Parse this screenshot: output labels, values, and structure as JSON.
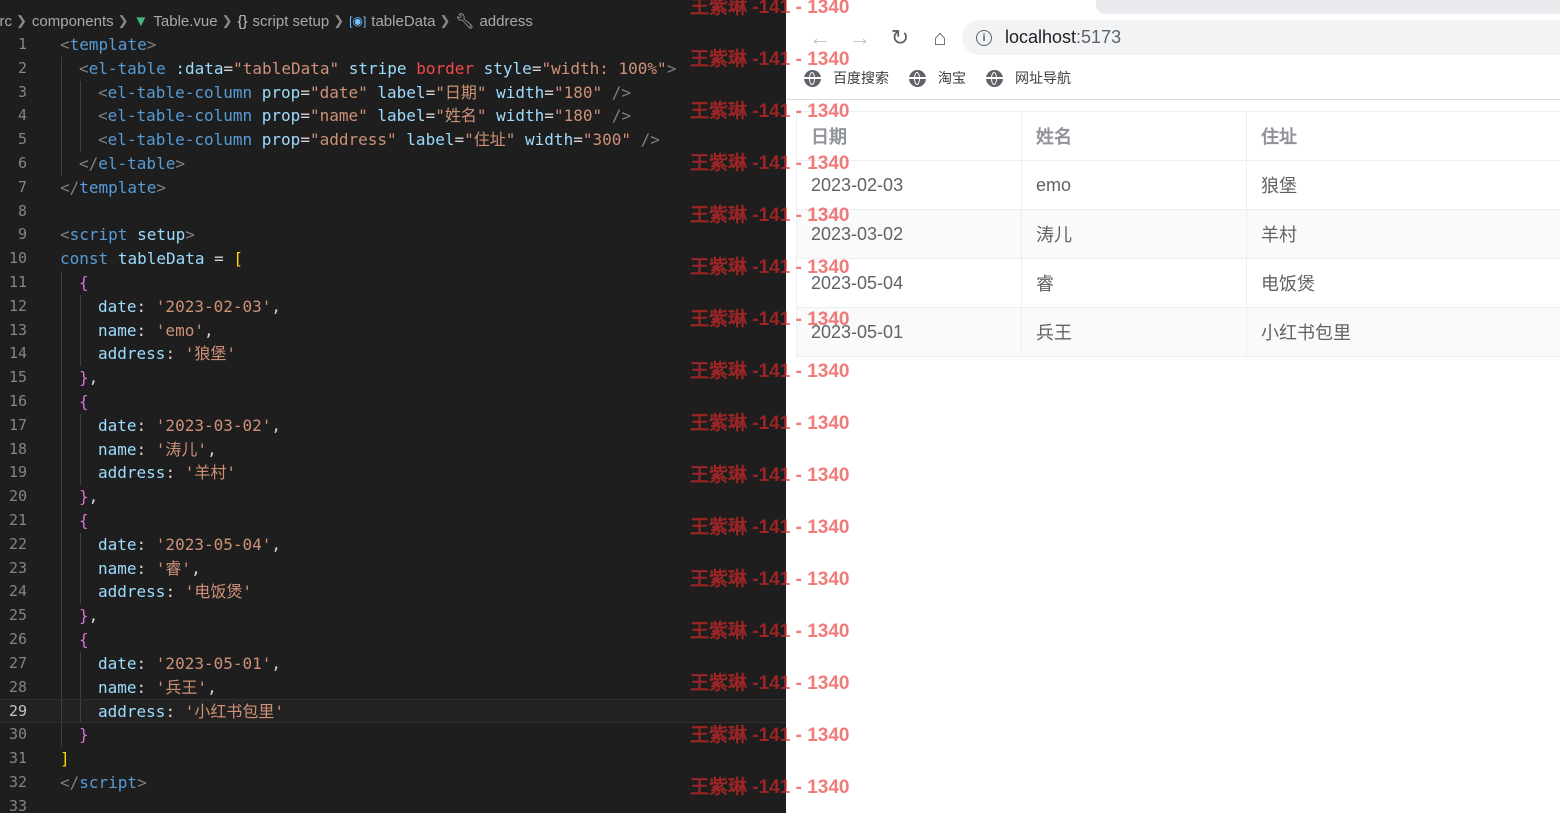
{
  "editor": {
    "breadcrumb": [
      "src",
      "components",
      "Table.vue",
      "script setup",
      "tableData",
      "address"
    ],
    "current_line": 29,
    "lines": [
      {
        "n": "1",
        "indent": 0,
        "tokens": [
          [
            "t-punct",
            "<"
          ],
          [
            "t-tag",
            "template"
          ],
          [
            "t-punct",
            ">"
          ]
        ]
      },
      {
        "n": "2",
        "indent": 1,
        "tokens": [
          [
            "t-punct",
            "<"
          ],
          [
            "t-tag",
            "el-table"
          ],
          [
            "t-eq",
            " "
          ],
          [
            "t-attr",
            ":data"
          ],
          [
            "t-eq",
            "="
          ],
          [
            "t-str",
            "\"tableData\""
          ],
          [
            "t-eq",
            " "
          ],
          [
            "t-attr",
            "stripe"
          ],
          [
            "t-eq",
            " "
          ],
          [
            "t-red",
            "border"
          ],
          [
            "t-eq",
            " "
          ],
          [
            "t-attr",
            "style"
          ],
          [
            "t-eq",
            "="
          ],
          [
            "t-str",
            "\"width: 100%\""
          ],
          [
            "t-punct",
            ">"
          ]
        ]
      },
      {
        "n": "3",
        "indent": 2,
        "tokens": [
          [
            "t-punct",
            "<"
          ],
          [
            "t-tag",
            "el-table-column"
          ],
          [
            "t-eq",
            " "
          ],
          [
            "t-attr",
            "prop"
          ],
          [
            "t-eq",
            "="
          ],
          [
            "t-str",
            "\"date\""
          ],
          [
            "t-eq",
            " "
          ],
          [
            "t-attr",
            "label"
          ],
          [
            "t-eq",
            "="
          ],
          [
            "t-str",
            "\"日期\""
          ],
          [
            "t-eq",
            " "
          ],
          [
            "t-attr",
            "width"
          ],
          [
            "t-eq",
            "="
          ],
          [
            "t-str",
            "\"180\""
          ],
          [
            "t-eq",
            " "
          ],
          [
            "t-punct",
            "/>"
          ]
        ]
      },
      {
        "n": "4",
        "indent": 2,
        "tokens": [
          [
            "t-punct",
            "<"
          ],
          [
            "t-tag",
            "el-table-column"
          ],
          [
            "t-eq",
            " "
          ],
          [
            "t-attr",
            "prop"
          ],
          [
            "t-eq",
            "="
          ],
          [
            "t-str",
            "\"name\""
          ],
          [
            "t-eq",
            " "
          ],
          [
            "t-attr",
            "label"
          ],
          [
            "t-eq",
            "="
          ],
          [
            "t-str",
            "\"姓名\""
          ],
          [
            "t-eq",
            " "
          ],
          [
            "t-attr",
            "width"
          ],
          [
            "t-eq",
            "="
          ],
          [
            "t-str",
            "\"180\""
          ],
          [
            "t-eq",
            " "
          ],
          [
            "t-punct",
            "/>"
          ]
        ]
      },
      {
        "n": "5",
        "indent": 2,
        "tokens": [
          [
            "t-punct",
            "<"
          ],
          [
            "t-tag",
            "el-table-column"
          ],
          [
            "t-eq",
            " "
          ],
          [
            "t-attr",
            "prop"
          ],
          [
            "t-eq",
            "="
          ],
          [
            "t-str",
            "\"address\""
          ],
          [
            "t-eq",
            " "
          ],
          [
            "t-attr",
            "label"
          ],
          [
            "t-eq",
            "="
          ],
          [
            "t-str",
            "\"住址\""
          ],
          [
            "t-eq",
            " "
          ],
          [
            "t-attr",
            "width"
          ],
          [
            "t-eq",
            "="
          ],
          [
            "t-str",
            "\"300\""
          ],
          [
            "t-eq",
            " "
          ],
          [
            "t-punct",
            "/>"
          ]
        ]
      },
      {
        "n": "6",
        "indent": 1,
        "tokens": [
          [
            "t-punct",
            "</"
          ],
          [
            "t-tag",
            "el-table"
          ],
          [
            "t-punct",
            ">"
          ]
        ]
      },
      {
        "n": "7",
        "indent": 0,
        "tokens": [
          [
            "t-punct",
            "</"
          ],
          [
            "t-tag",
            "template"
          ],
          [
            "t-punct",
            ">"
          ]
        ]
      },
      {
        "n": "8",
        "indent": 0,
        "tokens": []
      },
      {
        "n": "9",
        "indent": 0,
        "tokens": [
          [
            "t-punct",
            "<"
          ],
          [
            "t-tag",
            "script"
          ],
          [
            "t-eq",
            " "
          ],
          [
            "t-attr",
            "setup"
          ],
          [
            "t-punct",
            ">"
          ]
        ]
      },
      {
        "n": "10",
        "indent": 0,
        "tokens": [
          [
            "t-kw",
            "const"
          ],
          [
            "t-eq",
            " "
          ],
          [
            "t-var",
            "tableData"
          ],
          [
            "t-eq",
            " = "
          ],
          [
            "t-b1",
            "["
          ]
        ]
      },
      {
        "n": "11",
        "indent": 1,
        "tokens": [
          [
            "t-b2",
            "{"
          ]
        ]
      },
      {
        "n": "12",
        "indent": 2,
        "tokens": [
          [
            "t-var",
            "date"
          ],
          [
            "t-eq",
            ": "
          ],
          [
            "t-str",
            "'2023-02-03'"
          ],
          [
            "t-eq",
            ","
          ]
        ]
      },
      {
        "n": "13",
        "indent": 2,
        "tokens": [
          [
            "t-var",
            "name"
          ],
          [
            "t-eq",
            ": "
          ],
          [
            "t-str",
            "'emo'"
          ],
          [
            "t-eq",
            ","
          ]
        ]
      },
      {
        "n": "14",
        "indent": 2,
        "tokens": [
          [
            "t-var",
            "address"
          ],
          [
            "t-eq",
            ": "
          ],
          [
            "t-str",
            "'狼堡'"
          ]
        ]
      },
      {
        "n": "15",
        "indent": 1,
        "tokens": [
          [
            "t-b2",
            "}"
          ],
          [
            "t-eq",
            ","
          ]
        ]
      },
      {
        "n": "16",
        "indent": 1,
        "tokens": [
          [
            "t-b2",
            "{"
          ]
        ]
      },
      {
        "n": "17",
        "indent": 2,
        "tokens": [
          [
            "t-var",
            "date"
          ],
          [
            "t-eq",
            ": "
          ],
          [
            "t-str",
            "'2023-03-02'"
          ],
          [
            "t-eq",
            ","
          ]
        ]
      },
      {
        "n": "18",
        "indent": 2,
        "tokens": [
          [
            "t-var",
            "name"
          ],
          [
            "t-eq",
            ": "
          ],
          [
            "t-str",
            "'涛儿'"
          ],
          [
            "t-eq",
            ","
          ]
        ]
      },
      {
        "n": "19",
        "indent": 2,
        "tokens": [
          [
            "t-var",
            "address"
          ],
          [
            "t-eq",
            ": "
          ],
          [
            "t-str",
            "'羊村'"
          ]
        ]
      },
      {
        "n": "20",
        "indent": 1,
        "tokens": [
          [
            "t-b2",
            "}"
          ],
          [
            "t-eq",
            ","
          ]
        ]
      },
      {
        "n": "21",
        "indent": 1,
        "tokens": [
          [
            "t-b2",
            "{"
          ]
        ]
      },
      {
        "n": "22",
        "indent": 2,
        "tokens": [
          [
            "t-var",
            "date"
          ],
          [
            "t-eq",
            ": "
          ],
          [
            "t-str",
            "'2023-05-04'"
          ],
          [
            "t-eq",
            ","
          ]
        ]
      },
      {
        "n": "23",
        "indent": 2,
        "tokens": [
          [
            "t-var",
            "name"
          ],
          [
            "t-eq",
            ": "
          ],
          [
            "t-str",
            "'睿'"
          ],
          [
            "t-eq",
            ","
          ]
        ]
      },
      {
        "n": "24",
        "indent": 2,
        "tokens": [
          [
            "t-var",
            "address"
          ],
          [
            "t-eq",
            ": "
          ],
          [
            "t-str",
            "'电饭煲'"
          ]
        ]
      },
      {
        "n": "25",
        "indent": 1,
        "tokens": [
          [
            "t-b2",
            "}"
          ],
          [
            "t-eq",
            ","
          ]
        ]
      },
      {
        "n": "26",
        "indent": 1,
        "tokens": [
          [
            "t-b2",
            "{"
          ]
        ]
      },
      {
        "n": "27",
        "indent": 2,
        "tokens": [
          [
            "t-var",
            "date"
          ],
          [
            "t-eq",
            ": "
          ],
          [
            "t-str",
            "'2023-05-01'"
          ],
          [
            "t-eq",
            ","
          ]
        ]
      },
      {
        "n": "28",
        "indent": 2,
        "tokens": [
          [
            "t-var",
            "name"
          ],
          [
            "t-eq",
            ": "
          ],
          [
            "t-str",
            "'兵王'"
          ],
          [
            "t-eq",
            ","
          ]
        ]
      },
      {
        "n": "29",
        "indent": 2,
        "tokens": [
          [
            "t-var",
            "address"
          ],
          [
            "t-eq",
            ": "
          ],
          [
            "t-str",
            "'小红书包里'"
          ]
        ]
      },
      {
        "n": "30",
        "indent": 1,
        "tokens": [
          [
            "t-b2",
            "}"
          ]
        ]
      },
      {
        "n": "31",
        "indent": 0,
        "tokens": [
          [
            "t-b1",
            "]"
          ]
        ]
      },
      {
        "n": "32",
        "indent": 0,
        "tokens": [
          [
            "t-punct",
            "</"
          ],
          [
            "t-tag",
            "script"
          ],
          [
            "t-punct",
            ">"
          ]
        ]
      },
      {
        "n": "33",
        "indent": 0,
        "tokens": []
      }
    ]
  },
  "browser": {
    "url_host": "localhost",
    "url_port": ":5173",
    "bookmarks": [
      "百度搜索",
      "淘宝",
      "网址导航"
    ],
    "table": {
      "headers": [
        "日期",
        "姓名",
        "住址"
      ],
      "rows": [
        [
          "2023-02-03",
          "emo",
          "狼堡"
        ],
        [
          "2023-03-02",
          "涛儿",
          "羊村"
        ],
        [
          "2023-05-04",
          "睿",
          "电饭煲"
        ],
        [
          "2023-05-01",
          "兵王",
          "小红书包里"
        ]
      ]
    }
  },
  "watermark": {
    "text": "王紫琳 -141 - 1340",
    "repeat": 16
  }
}
